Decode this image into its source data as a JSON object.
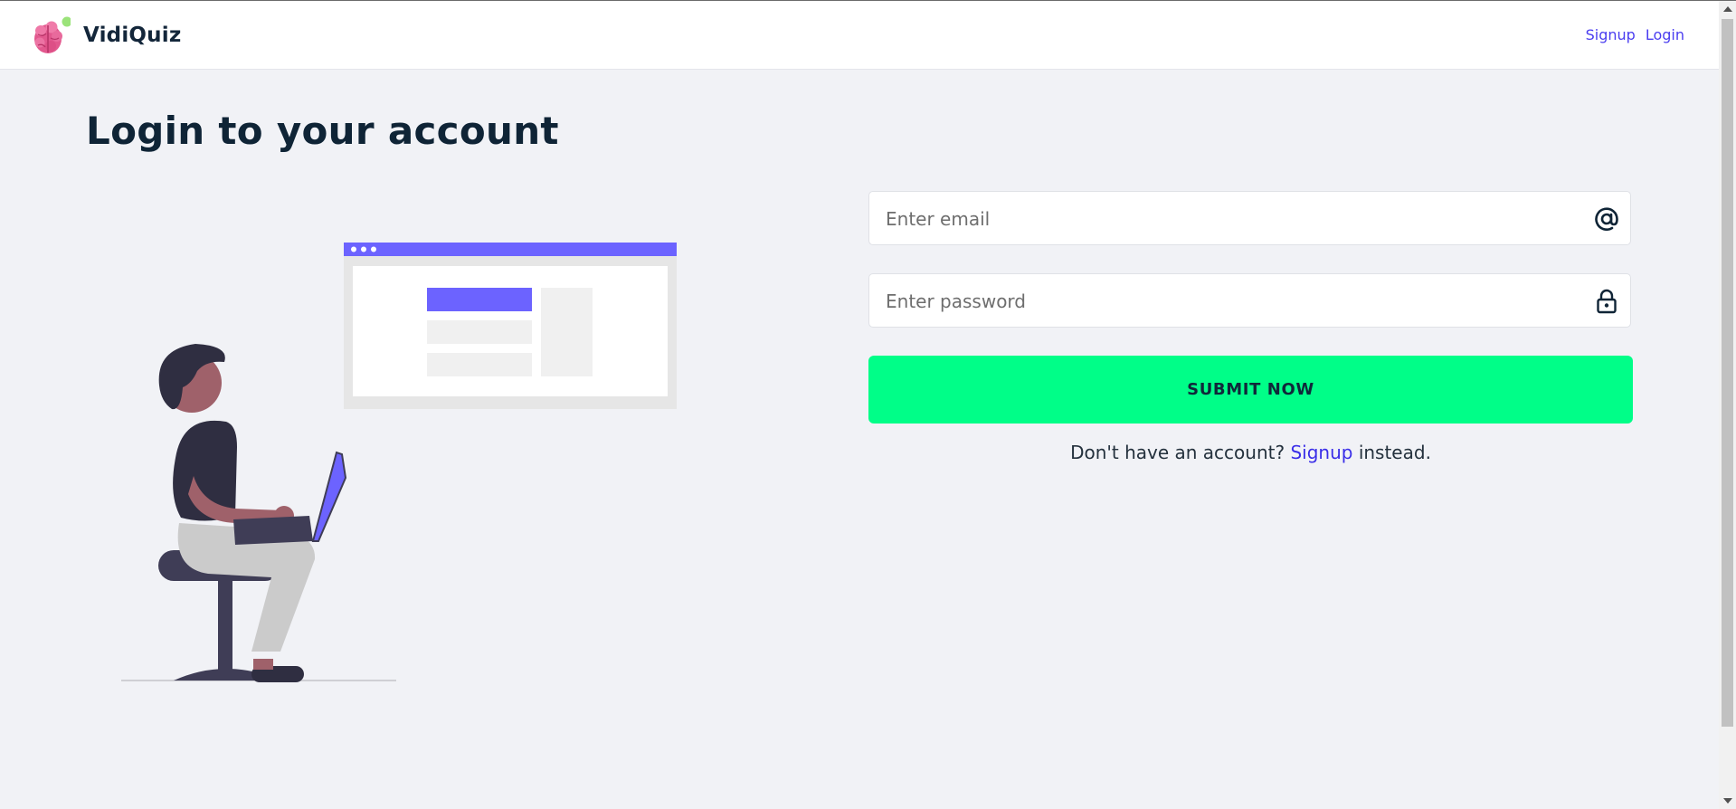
{
  "app": {
    "name": "VidiQuiz",
    "logo_icon": "brain-icon"
  },
  "nav": {
    "links": [
      {
        "label": "Signup"
      },
      {
        "label": "Login"
      }
    ]
  },
  "page": {
    "title": "Login to your account"
  },
  "form": {
    "email": {
      "placeholder": "Enter email",
      "value": "",
      "icon": "at-sign-icon"
    },
    "password": {
      "placeholder": "Enter password",
      "value": "",
      "icon": "lock-icon"
    },
    "submit_label": "SUBMIT NOW",
    "signup_prompt": "Don't have an account?",
    "signup_link": "Signup",
    "signup_suffix": "instead."
  },
  "colors": {
    "accent_green": "#00fe88",
    "link_blue": "#4a3df0",
    "illustration_purple": "#6c63ff",
    "page_background": "#f1f2f6"
  }
}
